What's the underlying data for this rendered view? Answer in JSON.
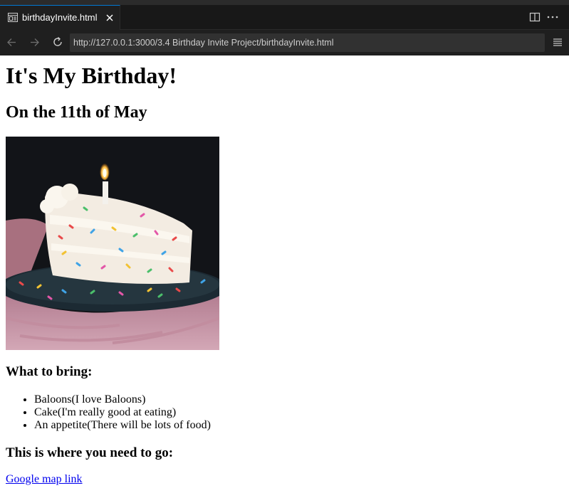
{
  "editor": {
    "tab": {
      "title": "birthdayInvite.html",
      "icon": "preview-icon"
    },
    "actions": [
      "split-editor-icon",
      "more-actions-icon"
    ],
    "colors": {
      "tabbar_bg": "#181818",
      "tab_bg": "#1f1f1f",
      "accent": "#0078d4",
      "url_bg": "#313131"
    }
  },
  "browser": {
    "url": "http://127.0.0.1:3000/3.4 Birthday Invite Project/birthdayInvite.html",
    "icons": [
      "back-arrow-icon",
      "forward-arrow-icon",
      "reload-icon",
      "hamburger-menu-icon"
    ]
  },
  "page": {
    "heading": "It's My Birthday!",
    "subheading": "On the 11th of May",
    "image_subject": "slice of funfetti birthday cake with lit candle",
    "bring_heading": "What to bring:",
    "bring_items": [
      "Baloons(I love Baloons)",
      "Cake(I'm really good at eating)",
      "An appetite(There will be lots of food)"
    ],
    "location_heading": "This is where you need to go:",
    "map_link": "Google map link"
  }
}
